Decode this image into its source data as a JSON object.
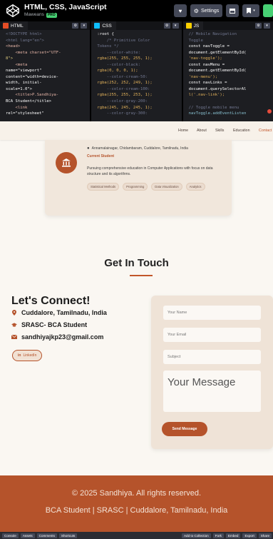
{
  "codepen": {
    "title": "HTML, CSS, JavaScript",
    "author": "Maweans",
    "badge": "PRO",
    "settings_label": "Settings",
    "accent": "#47cf73"
  },
  "editors": {
    "html": {
      "label": "HTML",
      "lines": [
        "<!DOCTYPE html>",
        "<html lang=\"en\">",
        "<head>",
        "    <meta charset=\"UTF-",
        "8\">",
        "    <meta",
        "name=\"viewport\"",
        "content=\"width=device-",
        "width, initial-",
        "scale=1.0\">",
        "    <title>P.Sandhiya-",
        "BCA Student</title>",
        "    <link",
        "rel=\"stylesheet\""
      ]
    },
    "css": {
      "label": "CSS",
      "lines": [
        ":root {",
        "    /* Primitive Color",
        "Tokens */",
        "    --color-white:",
        "rgba(255, 255, 255, 1);",
        "    --color-black:",
        "rgba(0, 0, 0, 1);",
        "    --color-cream-50:",
        "rgba(252, 252, 249, 1);",
        "    --color-cream-100:",
        "rgba(255, 255, 253, 1);",
        "    --color-gray-200:",
        "rgba(245, 245, 245, 1);",
        "    --color-gray-300:"
      ]
    },
    "js": {
      "label": "JS",
      "lines": [
        "// Mobile Navigation",
        "Toggle",
        "const navToggle =",
        "document.getElementById(",
        "'nav-toggle');",
        "const navMenu =",
        "document.getElementById(",
        "'nav-menu');",
        "const navLinks =",
        "document.querySelectorAl",
        "l('.nav-link');",
        "",
        "// Toggle mobile menu",
        "navToggle.addEventListen"
      ]
    }
  },
  "site": {
    "nav": [
      "Home",
      "About",
      "Skills",
      "Education",
      "Contact"
    ],
    "education": {
      "location": "Annamalainagar, Chidambaram, Cuddalore, Tamilnadu, India",
      "status": "Current Student",
      "description": "Pursuing comprehensive education in Computer Applications with focus on data structure and its algorithms.",
      "tags": [
        "Statistical Methods",
        "Programming",
        "Data Visualization",
        "Analytics"
      ]
    },
    "contact": {
      "heading": "Get In Touch",
      "connect_title": "Let's Connect!",
      "location": "Cuddalore, Tamilnadu, India",
      "role": "SRASC- BCA Student",
      "email": "sandhiyajkp23@gmail.com",
      "linkedin": "LinkedIn",
      "form": {
        "name_placeholder": "Your Name",
        "email_placeholder": "Your Email",
        "subject_placeholder": "Subject",
        "message_placeholder": "Your Message",
        "send_label": "Send Message"
      }
    },
    "footer": {
      "line1": "© 2025 Sandhiya. All rights reserved.",
      "line2": "BCA Student | SRASC | Cuddalore, Tamilnadu, India"
    },
    "colors": {
      "accent": "#b5532b",
      "background": "#faf7f2",
      "card": "#efe3d7"
    }
  },
  "bottombar": {
    "left": [
      "Console",
      "Assets",
      "Comments",
      "Shortcuts"
    ],
    "right": [
      "Add to Collection",
      "Fork",
      "Embed",
      "Export",
      "Share"
    ]
  }
}
